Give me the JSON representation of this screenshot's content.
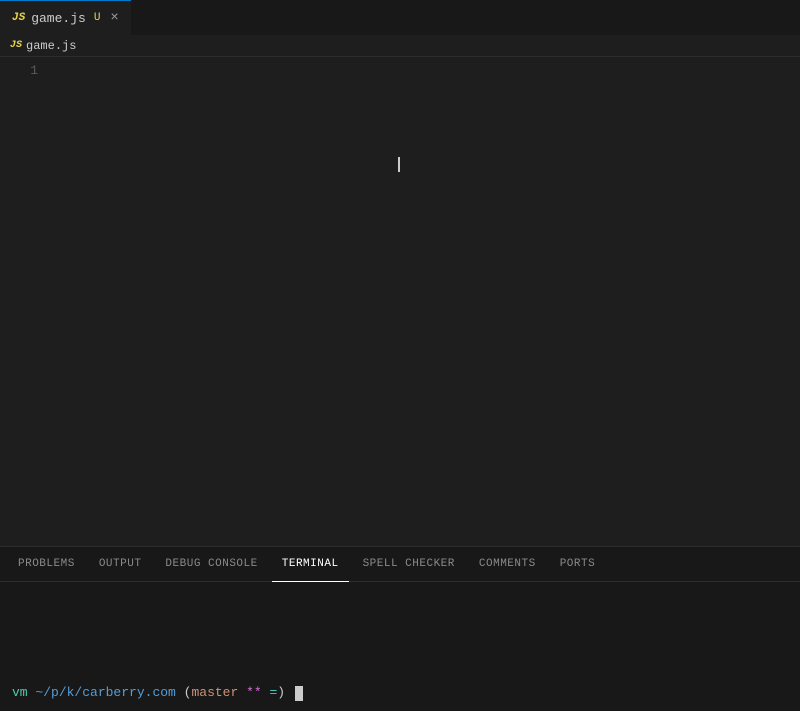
{
  "tabBar": {
    "tab": {
      "icon": "JS",
      "label": "game.js",
      "modified": "U",
      "close": "×"
    }
  },
  "breadcrumb": {
    "icon": "JS",
    "label": "game.js"
  },
  "editor": {
    "lineNumbers": [
      "1"
    ]
  },
  "panel": {
    "tabs": [
      {
        "label": "PROBLEMS",
        "active": false
      },
      {
        "label": "OUTPUT",
        "active": false
      },
      {
        "label": "DEBUG CONSOLE",
        "active": false
      },
      {
        "label": "TERMINAL",
        "active": true
      },
      {
        "label": "SPELL CHECKER",
        "active": false
      },
      {
        "label": "COMMENTS",
        "active": false
      },
      {
        "label": "PORTS",
        "active": false
      }
    ],
    "terminal": {
      "prefix": "vm",
      "path": "~/p/k/carberry.com",
      "branch_open": " (",
      "branch": "master",
      "branch_status1": " **",
      "branch_status2": " =",
      "branch_close": ")"
    }
  }
}
